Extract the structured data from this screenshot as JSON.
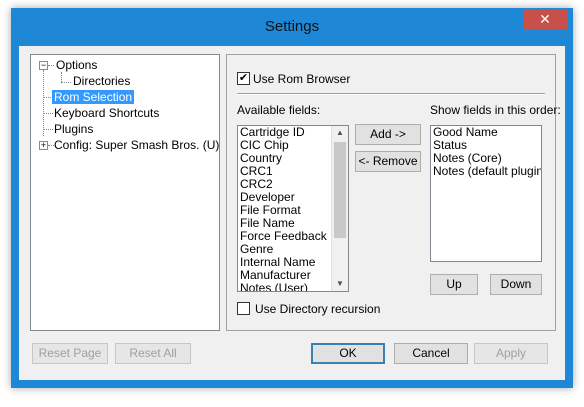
{
  "window": {
    "title": "Settings",
    "close_glyph": "✕"
  },
  "tree": {
    "items": [
      {
        "label": "Options"
      },
      {
        "label": "Directories"
      },
      {
        "label": "Rom Selection"
      },
      {
        "label": "Keyboard Shortcuts"
      },
      {
        "label": "Plugins"
      },
      {
        "label": "Config: Super Smash Bros. (U)"
      }
    ]
  },
  "panel": {
    "use_rom_browser_label": "Use Rom Browser",
    "use_rom_browser_checked": "✔",
    "available_fields_label": "Available fields:",
    "show_fields_label": "Show fields in this order:",
    "available_fields": [
      "Cartridge ID",
      "CIC Chip",
      "Country",
      "CRC1",
      "CRC2",
      "Developer",
      "File Format",
      "File Name",
      "Force Feedback",
      "Genre",
      "Internal Name",
      "Manufacturer",
      "Notes (User)"
    ],
    "shown_fields": [
      "Good Name",
      "Status",
      "Notes (Core)",
      "Notes (default plugins)"
    ],
    "add_label": "Add ->",
    "remove_label": "<- Remove",
    "up_label": "Up",
    "down_label": "Down",
    "use_dir_recursion_label": "Use Directory recursion"
  },
  "footer": {
    "reset_page_label": "Reset Page",
    "reset_all_label": "Reset All",
    "ok_label": "OK",
    "cancel_label": "Cancel",
    "apply_label": "Apply"
  }
}
